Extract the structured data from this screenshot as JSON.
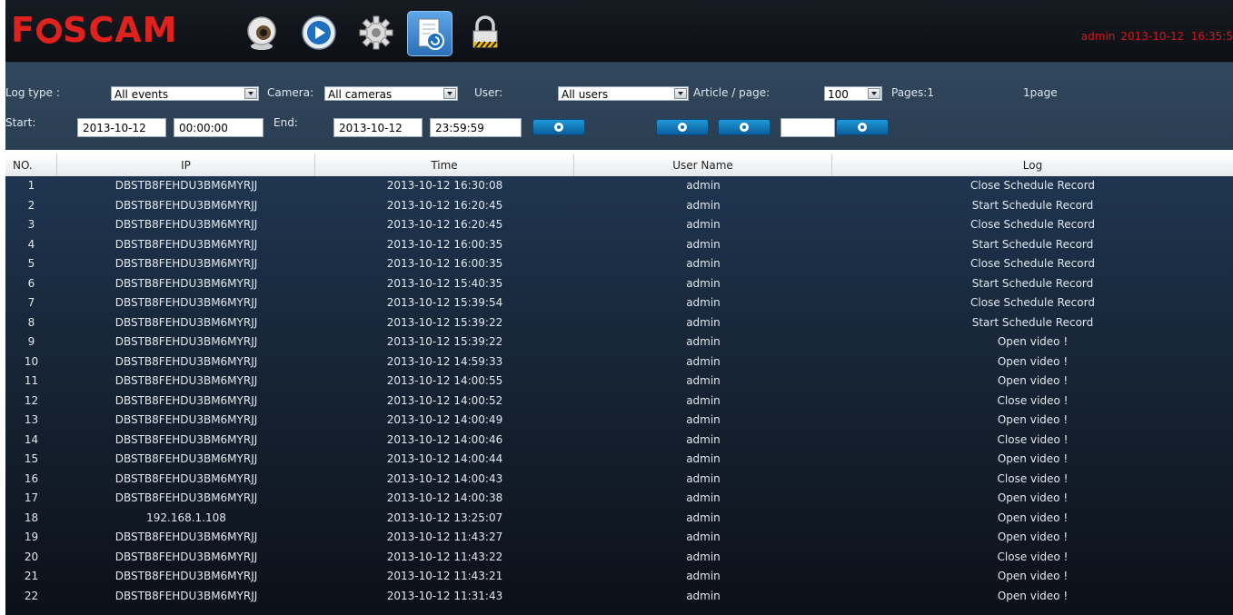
{
  "brand": {
    "logo_text": "FOSCAM",
    "accent": "#e0221e"
  },
  "toolbar": {
    "icons": [
      {
        "name": "live-video-icon"
      },
      {
        "name": "playback-icon"
      },
      {
        "name": "settings-icon"
      },
      {
        "name": "log-icon",
        "active": true
      },
      {
        "name": "logout-lock-icon"
      }
    ]
  },
  "user_info": {
    "user": "admin",
    "datetime": "2013-10-12  16:35:5"
  },
  "filters": {
    "log_type_label": "Log type :",
    "log_type_value": "All events",
    "camera_label": "Camera:",
    "camera_value": "All cameras",
    "user_label": "User:",
    "user_value": "All users",
    "article_label": "Article / page:",
    "article_value": "100",
    "pages_label": "Pages:1",
    "page_text": "1page",
    "start_label": "Start:",
    "start_date": "2013-10-12",
    "start_time": "00:00:00",
    "end_label": "End:",
    "end_date": "2013-10-12",
    "end_time": "23:59:59",
    "page_jump_value": ""
  },
  "table": {
    "columns": [
      "NO.",
      "IP",
      "Time",
      "User Name",
      "Log"
    ],
    "rows": [
      [
        "1",
        "DBSTB8FEHDU3BM6MYRJJ",
        "2013-10-12 16:30:08",
        "admin",
        "Close Schedule Record"
      ],
      [
        "2",
        "DBSTB8FEHDU3BM6MYRJJ",
        "2013-10-12 16:20:45",
        "admin",
        "Start Schedule Record"
      ],
      [
        "3",
        "DBSTB8FEHDU3BM6MYRJJ",
        "2013-10-12 16:20:45",
        "admin",
        "Close Schedule Record"
      ],
      [
        "4",
        "DBSTB8FEHDU3BM6MYRJJ",
        "2013-10-12 16:00:35",
        "admin",
        "Start Schedule Record"
      ],
      [
        "5",
        "DBSTB8FEHDU3BM6MYRJJ",
        "2013-10-12 16:00:35",
        "admin",
        "Close Schedule Record"
      ],
      [
        "6",
        "DBSTB8FEHDU3BM6MYRJJ",
        "2013-10-12 15:40:35",
        "admin",
        "Start Schedule Record"
      ],
      [
        "7",
        "DBSTB8FEHDU3BM6MYRJJ",
        "2013-10-12 15:39:54",
        "admin",
        "Close Schedule Record"
      ],
      [
        "8",
        "DBSTB8FEHDU3BM6MYRJJ",
        "2013-10-12 15:39:22",
        "admin",
        "Start Schedule Record"
      ],
      [
        "9",
        "DBSTB8FEHDU3BM6MYRJJ",
        "2013-10-12 15:39:22",
        "admin",
        "Open video !"
      ],
      [
        "10",
        "DBSTB8FEHDU3BM6MYRJJ",
        "2013-10-12 14:59:33",
        "admin",
        "Open video !"
      ],
      [
        "11",
        "DBSTB8FEHDU3BM6MYRJJ",
        "2013-10-12 14:00:55",
        "admin",
        "Open video !"
      ],
      [
        "12",
        "DBSTB8FEHDU3BM6MYRJJ",
        "2013-10-12 14:00:52",
        "admin",
        "Close video !"
      ],
      [
        "13",
        "DBSTB8FEHDU3BM6MYRJJ",
        "2013-10-12 14:00:49",
        "admin",
        "Open video !"
      ],
      [
        "14",
        "DBSTB8FEHDU3BM6MYRJJ",
        "2013-10-12 14:00:46",
        "admin",
        "Close video !"
      ],
      [
        "15",
        "DBSTB8FEHDU3BM6MYRJJ",
        "2013-10-12 14:00:44",
        "admin",
        "Open video !"
      ],
      [
        "16",
        "DBSTB8FEHDU3BM6MYRJJ",
        "2013-10-12 14:00:43",
        "admin",
        "Close video !"
      ],
      [
        "17",
        "DBSTB8FEHDU3BM6MYRJJ",
        "2013-10-12 14:00:38",
        "admin",
        "Open video !"
      ],
      [
        "18",
        "192.168.1.108",
        "2013-10-12 13:25:07",
        "admin",
        "Open video !"
      ],
      [
        "19",
        "DBSTB8FEHDU3BM6MYRJJ",
        "2013-10-12 11:43:27",
        "admin",
        "Open video !"
      ],
      [
        "20",
        "DBSTB8FEHDU3BM6MYRJJ",
        "2013-10-12 11:43:22",
        "admin",
        "Close video !"
      ],
      [
        "21",
        "DBSTB8FEHDU3BM6MYRJJ",
        "2013-10-12 11:43:21",
        "admin",
        "Open video !"
      ],
      [
        "22",
        "DBSTB8FEHDU3BM6MYRJJ",
        "2013-10-12 11:31:43",
        "admin",
        "Open video !"
      ]
    ]
  }
}
